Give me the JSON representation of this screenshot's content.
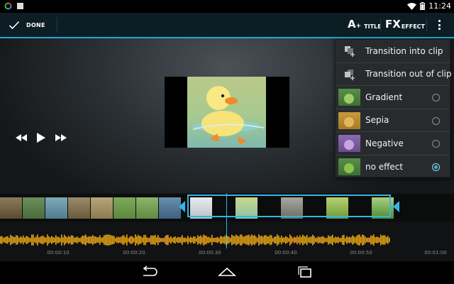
{
  "status_bar": {
    "time": "11:24"
  },
  "action_bar": {
    "done_label": "DONE",
    "title_button": {
      "glyph": "A",
      "label": "TITLE"
    },
    "effect_button": {
      "glyph": "FX",
      "label": "EFFECT"
    }
  },
  "menu": {
    "items": [
      {
        "label": "Transition into clip",
        "icon": "transition-in-icon"
      },
      {
        "label": "Transition out of clip",
        "icon": "transition-out-icon"
      },
      {
        "label": "Gradient",
        "selected": false
      },
      {
        "label": "Sepia",
        "selected": false
      },
      {
        "label": "Negative",
        "selected": false
      },
      {
        "label": "no effect",
        "selected": true
      }
    ]
  },
  "timeline": {
    "ticks": [
      "00:00:10",
      "00:00:20",
      "00:00:30",
      "00:00:40",
      "00:00:50",
      "00:01:00"
    ]
  },
  "colors": {
    "accent": "#33b5e5",
    "audio_wave": "#e8a317",
    "action_bar": "#0d1d24"
  }
}
